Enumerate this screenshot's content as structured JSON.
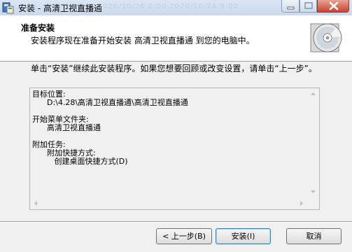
{
  "window": {
    "title": "安装 - 高清卫视直播通",
    "faint_text": "2020/10/26 0:00    2020/10/26 9:00"
  },
  "header": {
    "title": "准备安装",
    "subtitle": "安装程序现在准备开始安装 高清卫视直播通 到您的电脑中。"
  },
  "instruction": "单击“安装”继续此安装程序。如果您想要回顾或改变设置，请单击“上一步”。",
  "summary": {
    "dest_label": "目标位置:",
    "dest_value": "      D:\\4.28\\高清卫视直播通\\高清卫视直播通",
    "menu_label": "开始菜单文件夹:",
    "menu_value": "      高清卫视直播通",
    "tasks_label": "附加任务:",
    "tasks_group": "      附加快捷方式:",
    "tasks_item": "         创建桌面快捷方式(D)"
  },
  "buttons": {
    "back": "< 上一步(B)",
    "install": "安装(I)",
    "cancel": "取消"
  },
  "icons": {
    "app": "installer-icon",
    "header": "cd-disc-icon"
  }
}
